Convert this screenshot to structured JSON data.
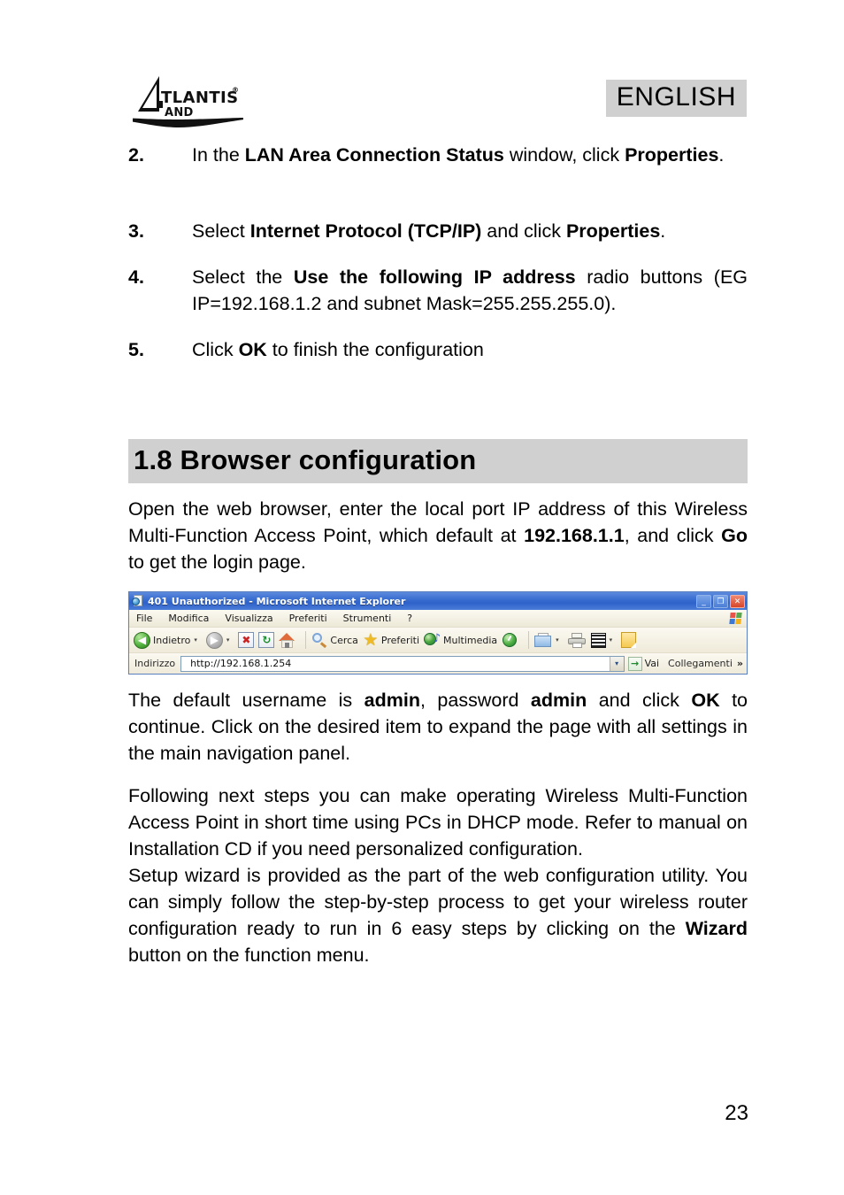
{
  "header": {
    "logo_primary": "ATLANTIS",
    "logo_secondary": "LAND",
    "logo_registered": "®",
    "language_badge": "ENGLISH"
  },
  "steps": [
    {
      "number": "2.",
      "segments": [
        {
          "text": "In the ",
          "bold": false
        },
        {
          "text": "LAN Area Connection Status",
          "bold": true
        },
        {
          "text": " window, click ",
          "bold": false
        },
        {
          "text": "Properties",
          "bold": true
        },
        {
          "text": ".",
          "bold": false
        }
      ]
    },
    {
      "number": "3.",
      "segments": [
        {
          "text": "Select ",
          "bold": false
        },
        {
          "text": "Internet Protocol (TCP/IP)",
          "bold": true
        },
        {
          "text": " and click ",
          "bold": false
        },
        {
          "text": "Properties",
          "bold": true
        },
        {
          "text": ".",
          "bold": false
        }
      ]
    },
    {
      "number": "4.",
      "segments": [
        {
          "text": "Select the ",
          "bold": false
        },
        {
          "text": "Use the following IP address",
          "bold": true
        },
        {
          "text": " radio buttons (EG IP=192.168.1.2 and subnet Mask=255.255.255.0).",
          "bold": false
        }
      ]
    },
    {
      "number": "5.",
      "segments": [
        {
          "text": "Click ",
          "bold": false
        },
        {
          "text": "OK",
          "bold": true
        },
        {
          "text": " to finish the configuration",
          "bold": false
        }
      ]
    }
  ],
  "section": {
    "heading": "1.8 Browser configuration"
  },
  "paragraphs": [
    {
      "id": "intro",
      "segments": [
        {
          "text": "Open the web browser, enter the local port IP address of this Wireless Multi-Function Access Point, which default at ",
          "bold": false
        },
        {
          "text": "192.168.1.1",
          "bold": true
        },
        {
          "text": ", and click ",
          "bold": false
        },
        {
          "text": "Go",
          "bold": true
        },
        {
          "text": " to get the login page.",
          "bold": false
        }
      ]
    },
    {
      "id": "login",
      "segments": [
        {
          "text": "The default username is ",
          "bold": false
        },
        {
          "text": "admin",
          "bold": true
        },
        {
          "text": ", password ",
          "bold": false
        },
        {
          "text": "admin",
          "bold": true
        },
        {
          "text": " and click ",
          "bold": false
        },
        {
          "text": "OK",
          "bold": true
        },
        {
          "text": " to continue. Click on the desired item to expand the page with all settings in the main navigation panel.",
          "bold": false
        }
      ]
    },
    {
      "id": "following",
      "segments": [
        {
          "text": "Following next steps you can make operating Wireless Multi-Function Access Point in short time using PCs  in DHCP mode.  Refer to manual on Installation CD if you need personalized configuration.",
          "bold": false
        }
      ]
    },
    {
      "id": "wizard",
      "segments": [
        {
          "text": "Setup wizard is provided as the part of the web configuration utility. You can simply follow the step-by-step process to get your wireless router configuration ready to run in 6 easy steps by clicking on the ",
          "bold": false
        },
        {
          "text": "Wizard",
          "bold": true
        },
        {
          "text": " button on the function menu.",
          "bold": false
        }
      ]
    }
  ],
  "browser": {
    "title": "401 Unauthorized - Microsoft Internet Explorer",
    "window_buttons": {
      "minimize": "_",
      "restore": "❐",
      "close": "✕"
    },
    "menu": [
      "File",
      "Modifica",
      "Visualizza",
      "Preferiti",
      "Strumenti",
      "?"
    ],
    "toolbar": {
      "back_label": "Indietro",
      "search_label": "Cerca",
      "favorites_label": "Preferiti",
      "multimedia_label": "Multimedia",
      "caret": "▾",
      "back_arrow": "◀",
      "forward_arrow": "▶",
      "stop_mark": "✖",
      "refresh_mark": "↻",
      "music_note": "♪"
    },
    "address": {
      "label": "Indirizzo",
      "value": "http://192.168.1.254",
      "dropdown_caret": "▾",
      "go_label": "Vai",
      "go_arrow": "→",
      "links_label": "Collegamenti",
      "overflow_chevron": "»"
    }
  },
  "footer": {
    "page_number": "23"
  },
  "colors": {
    "badge_background": "#d0d0d0",
    "section_background": "#d0d0d0",
    "titlebar_blue": "#3b6fd1",
    "toolbar_cream": "#f4f0e2",
    "text": "#000000"
  }
}
